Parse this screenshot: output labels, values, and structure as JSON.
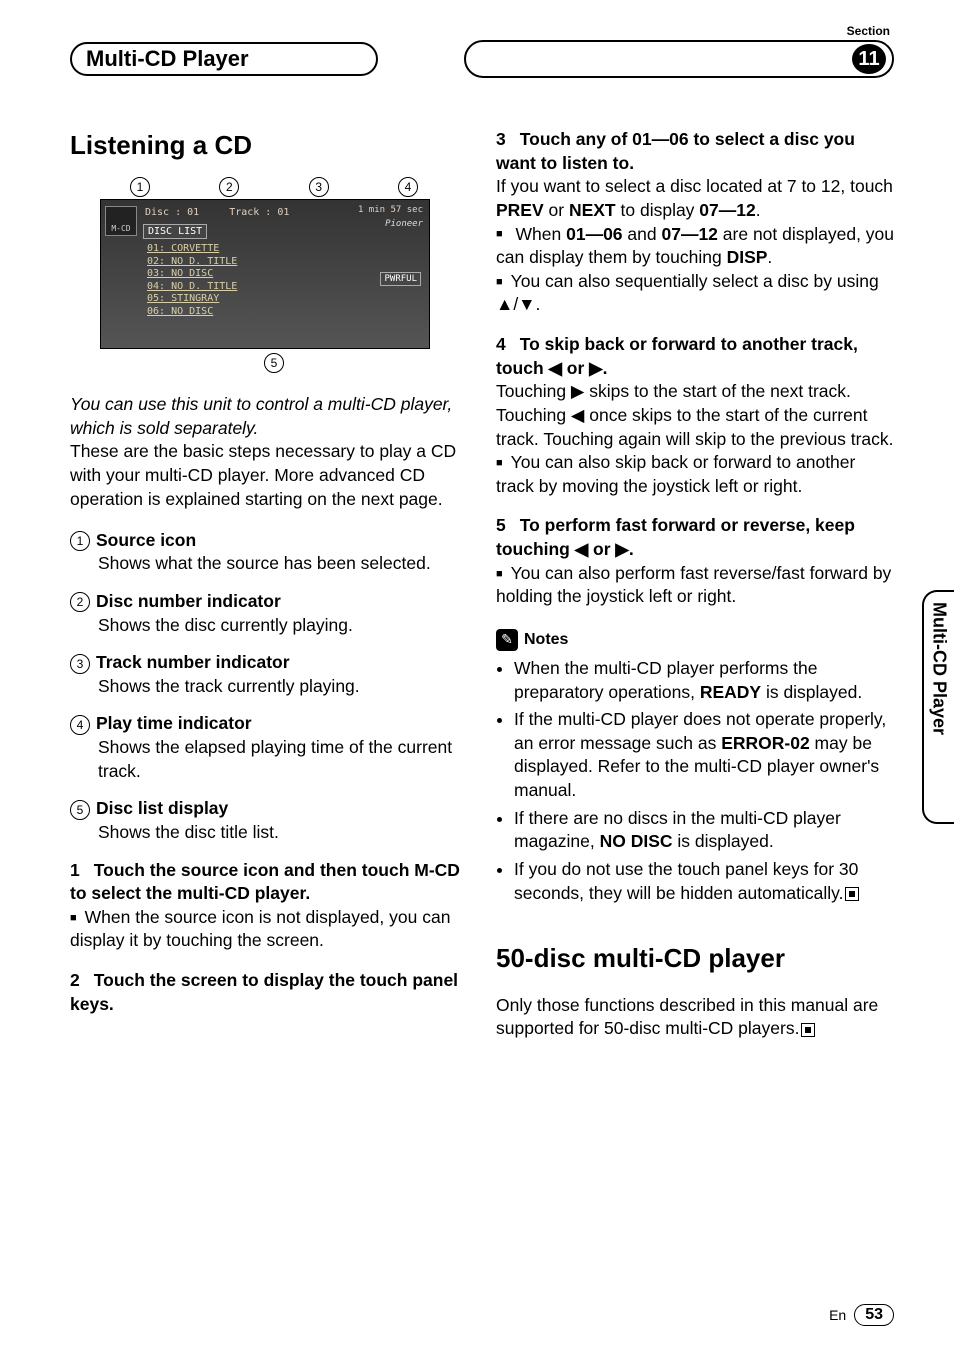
{
  "header": {
    "title": "Multi-CD Player",
    "section_label": "Section",
    "section_number": "11"
  },
  "side_tab": "Multi-CD Player",
  "footer": {
    "lang": "En",
    "page": "53"
  },
  "left": {
    "heading": "Listening a CD",
    "callouts_top": [
      "1",
      "2",
      "3",
      "4"
    ],
    "callouts_bottom": [
      "5"
    ],
    "screen": {
      "src_label": "M-CD",
      "disc_info": "Disc : 01",
      "track_info": "Track : 01",
      "time": "1 min 57 sec",
      "brand": "Pioneer",
      "panel_label": "DISC LIST",
      "list": [
        "01: CORVETTE",
        "02: NO D. TITLE",
        "03: NO DISC",
        "04: NO D. TITLE",
        "05: STINGRAY",
        "06: NO DISC"
      ],
      "side_btn": "PWRFUL"
    },
    "intro_italic": "You can use this unit to control a multi-CD player, which is sold separately.",
    "intro_rest": "These are the basic steps necessary to play a CD with your multi-CD player. More advanced CD operation is explained starting on the next page.",
    "indicators": [
      {
        "n": "1",
        "title": "Source icon",
        "desc": "Shows what the source has been selected."
      },
      {
        "n": "2",
        "title": "Disc number indicator",
        "desc": "Shows the disc currently playing."
      },
      {
        "n": "3",
        "title": "Track number indicator",
        "desc": "Shows the track currently playing."
      },
      {
        "n": "4",
        "title": "Play time indicator",
        "desc": "Shows the elapsed playing time of the current track."
      },
      {
        "n": "5",
        "title": "Disc list display",
        "desc": "Shows the disc title list."
      }
    ],
    "steps": [
      {
        "n": "1",
        "head": "Touch the source icon and then touch M-CD to select the multi-CD player.",
        "body": "When the source icon is not displayed, you can display it by touching the screen.",
        "bullet": true
      },
      {
        "n": "2",
        "head": "Touch the screen to display the touch panel keys.",
        "body": "",
        "bullet": false
      }
    ]
  },
  "right": {
    "steps": [
      {
        "n": "3",
        "head": "Touch any of 01—06 to select a disc you want to listen to.",
        "body1": "If you want to select a disc located at 7 to 12, touch ",
        "b1": "PREV",
        "mid1": " or ",
        "b2": "NEXT",
        "mid2": " to display ",
        "b3": "07—12",
        "tail1": ".",
        "bullets": [
          {
            "pre": "When ",
            "b1": "01—06",
            "mid": " and ",
            "b2": "07—12",
            "post": " are not displayed, you can display them by touching ",
            "b3": "DISP",
            "end": "."
          },
          {
            "plain": "You can also sequentially select a disc by using ▲/▼."
          }
        ]
      },
      {
        "n": "4",
        "head": "To skip back or forward to another track, touch ◀ or ▶.",
        "body": "Touching ▶ skips to the start of the next track. Touching ◀ once skips to the start of the current track. Touching again will skip to the previous track.",
        "bullets": [
          {
            "plain": "You can also skip back or forward to another track by moving the joystick left or right."
          }
        ]
      },
      {
        "n": "5",
        "head": "To perform fast forward or reverse, keep touching ◀ or ▶.",
        "bullets": [
          {
            "plain": "You can also perform fast reverse/fast forward by holding the joystick left or right."
          }
        ]
      }
    ],
    "notes_label": "Notes",
    "notes": [
      {
        "pre": "When the multi-CD player performs the preparatory operations, ",
        "b": "READY",
        "post": " is displayed."
      },
      {
        "pre": "If the multi-CD player does not operate properly, an error message such as ",
        "b": "ERROR-02",
        "post": " may be displayed. Refer to the multi-CD player owner's manual."
      },
      {
        "pre": "If there are no discs in the multi-CD player magazine, ",
        "b": "NO DISC",
        "post": " is displayed."
      },
      {
        "plain": "If you do not use the touch panel keys for 30 seconds, they will be hidden automatically."
      }
    ],
    "heading2": "50-disc multi-CD player",
    "body2": "Only those functions described in this manual are supported for 50-disc multi-CD players."
  }
}
